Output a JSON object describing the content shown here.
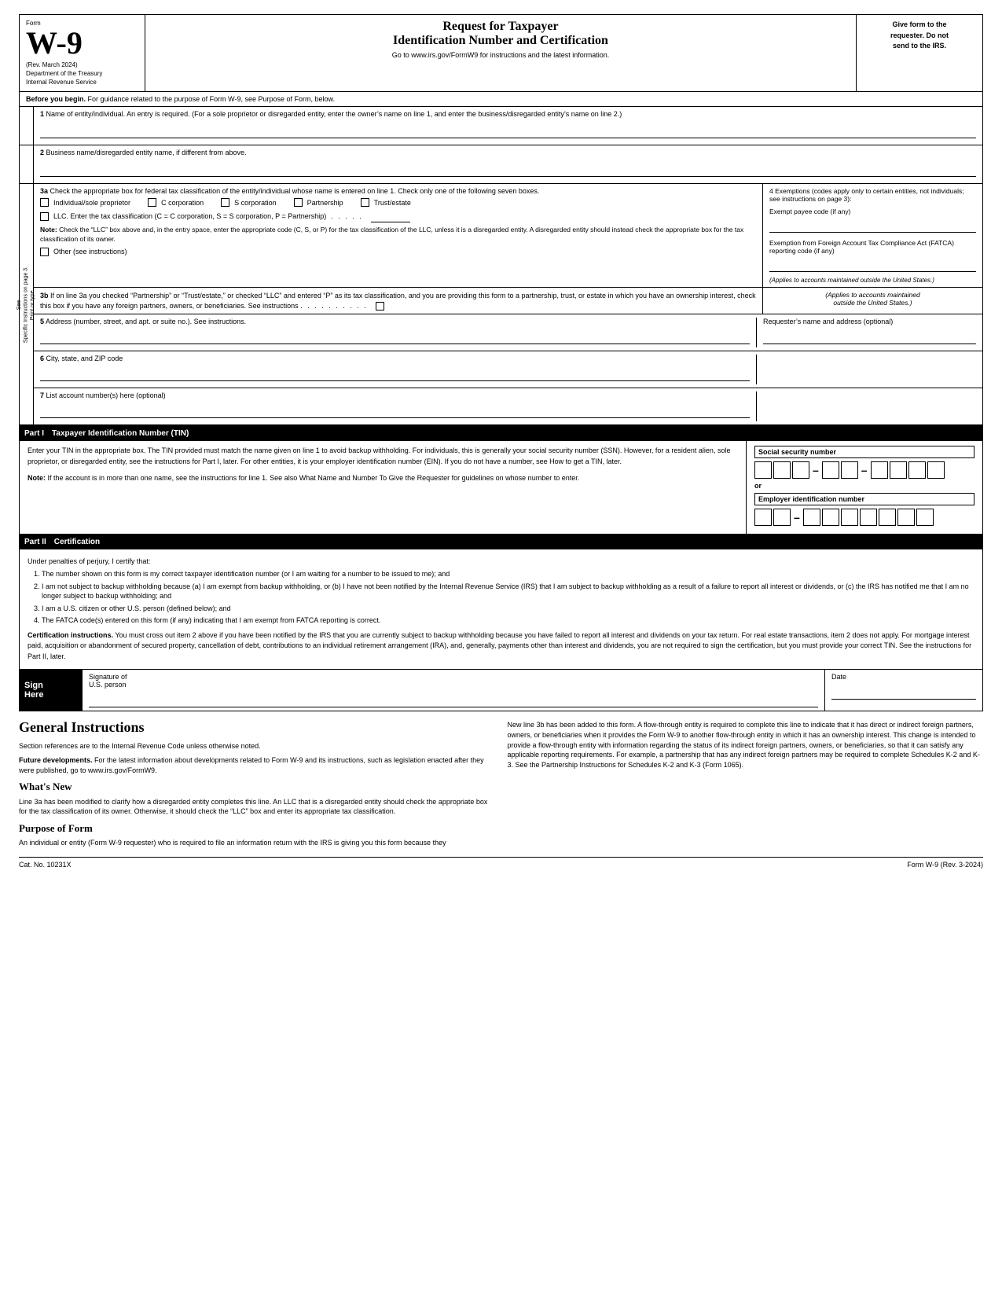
{
  "header": {
    "form_label": "Form",
    "form_number": "W-9",
    "rev_date": "(Rev. March 2024)",
    "dept": "Department of the Treasury",
    "irs": "Internal Revenue Service",
    "title_line1": "Request for Taxpayer",
    "title_line2": "Identification Number and Certification",
    "subtitle": "Go to www.irs.gov/FormW9 for instructions and the latest information.",
    "right_text": "Give form to the\nrequester. Do not\nsend to the IRS."
  },
  "before_begin": {
    "label": "Before you begin.",
    "text": "For guidance related to the purpose of Form W-9, see Purpose of Form, below."
  },
  "fields": {
    "line1_label": "1",
    "line1_text": "Name of entity/individual. An entry is required. (For a sole proprietor or disregarded entity, enter the owner’s name on line 1, and enter the business/disregarded entity’s name on line 2.)",
    "line2_label": "2",
    "line2_text": "Business name/disregarded entity name, if different from above.",
    "line3a_label": "3a",
    "line3a_text": "Check the appropriate box for federal tax classification of the entity/individual whose name is entered on line 1. Check only one of the following seven boxes.",
    "checkbox_individual": "Individual/sole proprietor",
    "checkbox_ccorp": "C corporation",
    "checkbox_scorp": "S corporation",
    "checkbox_partnership": "Partnership",
    "checkbox_trust": "Trust/estate",
    "checkbox_llc": "LLC. Enter the tax classification (C = C corporation, S = S corporation, P = Partnership)",
    "llc_dots": ". . . . .",
    "note_label": "Note:",
    "note_text": "Check the “LLC” box above and, in the entry space, enter the appropriate code (C, S, or P) for the tax classification of the LLC, unless it is a disregarded entity. A disregarded entity should instead check the appropriate box for the tax classification of its owner.",
    "checkbox_other": "Other (see instructions)",
    "line3b_label": "3b",
    "line3b_text": "If on line 3a you checked “Partnership” or “Trust/estate,” or checked “LLC” and entered “P” as its tax classification, and you are providing this form to a partnership, trust, or estate in which you have an ownership interest, check this box if you have any foreign partners, owners, or beneficiaries. See instructions",
    "line3b_dots": ". . . . . . . . . .",
    "line5_label": "5",
    "line5_text": "Address (number, street, and apt. or suite no.). See instructions.",
    "line5_right": "Requester’s name and address (optional)",
    "line6_label": "6",
    "line6_text": "City, state, and ZIP code",
    "line7_label": "7",
    "line7_text": "List account number(s) here (optional)"
  },
  "side_labels": {
    "print_or_type": "Print or type.",
    "specific_instructions": "Specific Instructions on page 3.",
    "see": "See"
  },
  "exemptions": {
    "title": "4 Exemptions (codes apply only to certain entities, not individuals; see instructions on page 3):",
    "exempt_payee": "Exempt payee code (if any)",
    "fatca_label": "Exemption from Foreign Account Tax Compliance Act (FATCA) reporting code (if any)",
    "applies_note": "(Applies to accounts maintained outside the United States.)"
  },
  "part1": {
    "label": "Part I",
    "title": "Taxpayer Identification Number (TIN)",
    "instruction": "Enter your TIN in the appropriate box. The TIN provided must match the name given on line 1 to avoid backup withholding. For individuals, this is generally your social security number (SSN). However, for a resident alien, sole proprietor, or disregarded entity, see the instructions for Part I, later. For other entities, it is your employer identification number (EIN). If you do not have a number, see How to get a TIN, later.",
    "note": "Note:",
    "note_text": "If the account is in more than one name, see the instructions for line 1. See also What Name and Number To Give the Requester for guidelines on whose number to enter.",
    "ssn_label": "Social security number",
    "ein_label": "Employer identification number",
    "or": "or"
  },
  "part2": {
    "label": "Part II",
    "title": "Certification",
    "under_penalties": "Under penalties of perjury, I certify that:",
    "item1": "The number shown on this form is my correct taxpayer identification number (or I am waiting for a number to be issued to me); and",
    "item2": "I am not subject to backup withholding because (a) I am exempt from backup withholding, or (b) I have not been notified by the Internal Revenue Service (IRS) that I am subject to backup withholding as a result of a failure to report all interest or dividends, or (c) the IRS has notified me that I am no longer subject to backup withholding; and",
    "item3": "I am a U.S. citizen or other U.S. person (defined below); and",
    "item4": "The FATCA code(s) entered on this form (if any) indicating that I am exempt from FATCA reporting is correct.",
    "cert_instructions_label": "Certification instructions.",
    "cert_instructions_text": "You must cross out item 2 above if you have been notified by the IRS that you are currently subject to backup withholding because you have failed to report all interest and dividends on your tax return. For real estate transactions, item 2 does not apply. For mortgage interest paid, acquisition or abandonment of secured property, cancellation of debt, contributions to an individual retirement arrangement (IRA), and, generally, payments other than interest and dividends, you are not required to sign the certification, but you must provide your correct TIN. See the instructions for Part II, later."
  },
  "sign": {
    "label_line1": "Sign",
    "label_line2": "Here",
    "signature_label": "Signature of",
    "us_person": "U.S. person",
    "date_label": "Date"
  },
  "general": {
    "title": "General Instructions",
    "section_refs": "Section references are to the Internal Revenue Code unless otherwise noted.",
    "future_dev_label": "Future developments.",
    "future_dev_text": "For the latest information about developments related to Form W-9 and its instructions, such as legislation enacted after they were published, go to www.irs.gov/FormW9.",
    "whats_new_title": "What's New",
    "whats_new_text": "Line 3a has been modified to clarify how a disregarded entity completes this line. An LLC that is a disregarded entity should check the appropriate box for the tax classification of its owner. Otherwise, it should check the “LLC” box and enter its appropriate tax classification.",
    "purpose_title": "Purpose of Form",
    "purpose_text": "An individual or entity (Form W-9 requester) who is required to file an information return with the IRS is giving you this form because they",
    "right_col_text": "New line 3b has been added to this form. A flow-through entity is required to complete this line to indicate that it has direct or indirect foreign partners, owners, or beneficiaries when it provides the Form W-9 to another flow-through entity in which it has an ownership interest. This change is intended to provide a flow-through entity with information regarding the status of its indirect foreign partners, owners, or beneficiaries, so that it can satisfy any applicable reporting requirements. For example, a partnership that has any indirect foreign partners may be required to complete Schedules K-2 and K-3. See the Partnership Instructions for Schedules K-2 and K-3 (Form 1065)."
  },
  "footer": {
    "cat_no": "Cat. No. 10231X",
    "form_ref": "Form W-9 (Rev. 3-2024)"
  }
}
